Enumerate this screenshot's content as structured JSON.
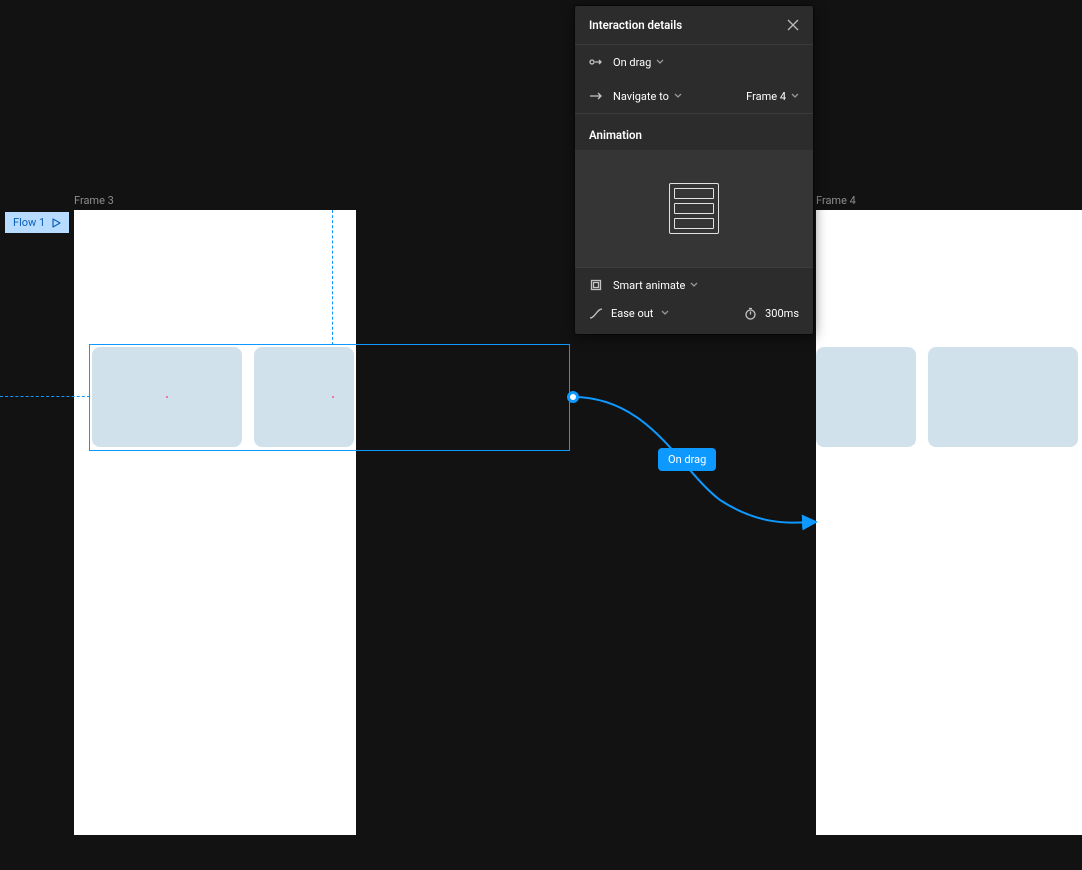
{
  "frames": {
    "left_label": "Frame 3",
    "right_label": "Frame 4"
  },
  "flow": {
    "label": "Flow 1"
  },
  "connector": {
    "trigger_label": "On drag"
  },
  "panel": {
    "title": "Interaction details",
    "trigger": {
      "label": "On drag"
    },
    "action": {
      "label": "Navigate to",
      "target": "Frame 4"
    },
    "animation_title": "Animation",
    "animate": {
      "type": "Smart animate"
    },
    "easing": {
      "label": "Ease out"
    },
    "duration": {
      "label": "300ms"
    }
  }
}
